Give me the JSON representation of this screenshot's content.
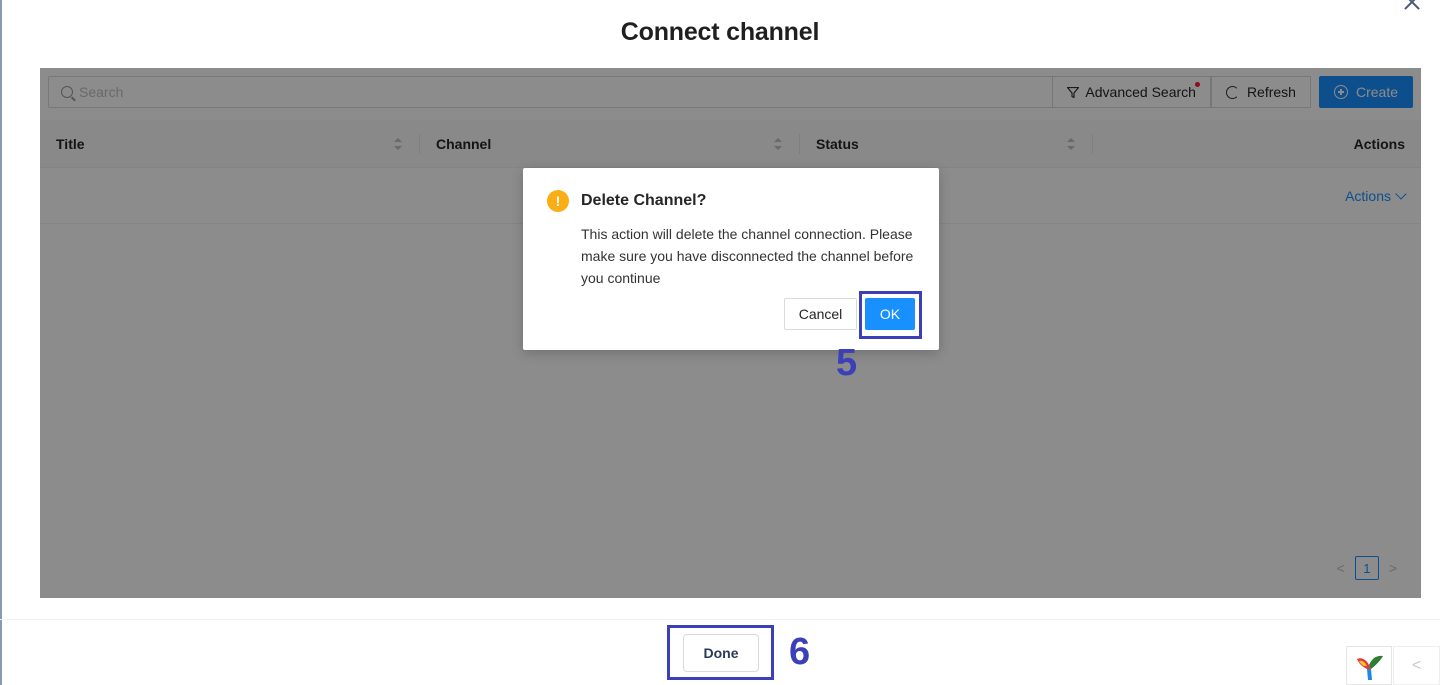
{
  "modal": {
    "title": "Connect channel"
  },
  "toolbar": {
    "search_placeholder": "Search",
    "advanced_search_label": "Advanced Search",
    "refresh_label": "Refresh",
    "create_label": "Create"
  },
  "table": {
    "columns": [
      "Title",
      "Channel",
      "Status",
      "Actions"
    ],
    "row_actions_label": "Actions"
  },
  "pagination": {
    "current_page": "1",
    "prev": "<",
    "next": ">"
  },
  "confirm_dialog": {
    "icon": "!",
    "title": "Delete Channel?",
    "message": "This action will delete the channel connection. Please make sure you have disconnected the channel before you continue",
    "cancel_label": "Cancel",
    "ok_label": "OK"
  },
  "annotations": {
    "step_ok": "5",
    "step_done": "6",
    "highlight_color": "#3b3fb8"
  },
  "footer": {
    "done_label": "Done",
    "collapse_glyph": "<"
  },
  "colors": {
    "primary": "#1890ff",
    "warning": "#faad14"
  }
}
